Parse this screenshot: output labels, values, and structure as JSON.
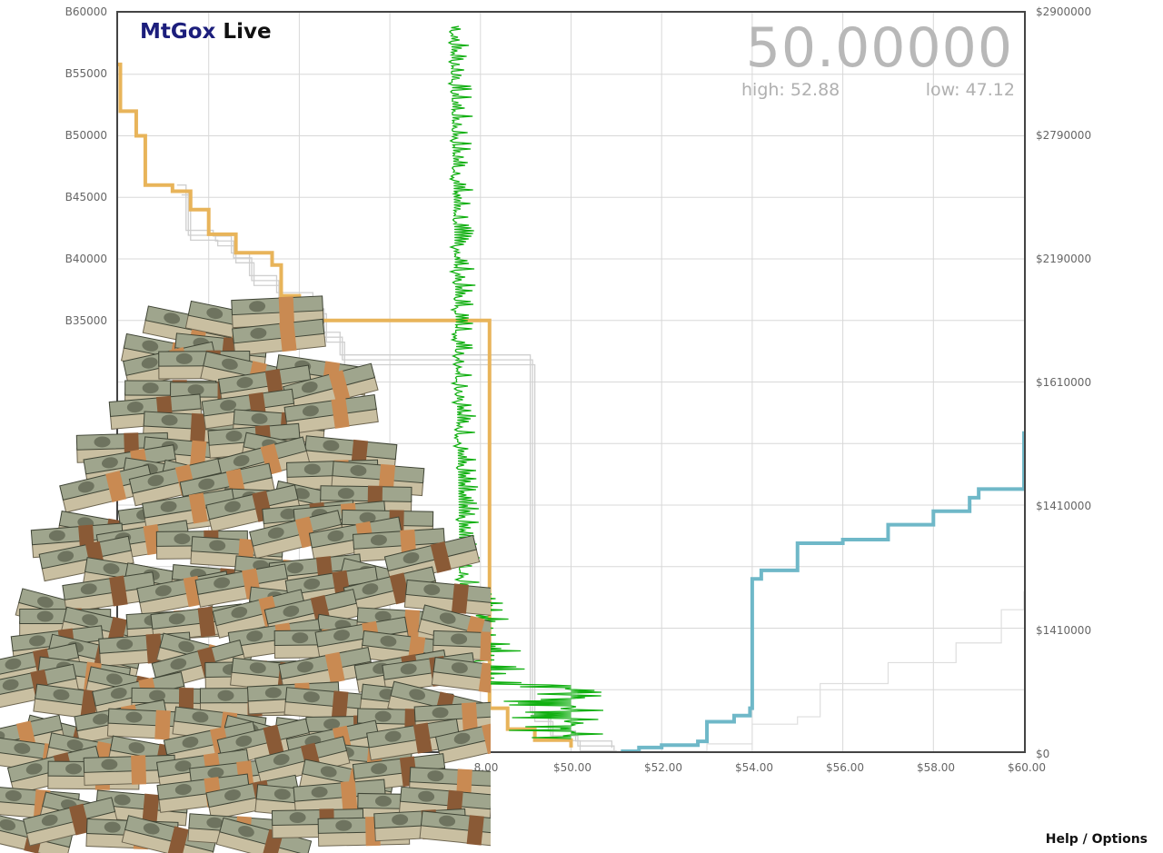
{
  "brand": {
    "part1": "MtGox",
    "part2": "Live"
  },
  "ticker": {
    "price": "50.00000",
    "high": "high: 52.88",
    "low": "low: 47.12"
  },
  "help_label": "Help / Options",
  "colors": {
    "bids": "#e8b45a",
    "asks": "#6fb8c8",
    "trades": "#12b012",
    "shadow": "#cfcfcf",
    "grid": "#d8d8d8"
  },
  "overlay_image": "pile-of-cash-image",
  "chart_data": {
    "type": "line",
    "title": "",
    "x_ticks": [
      "8.00",
      "$50.00",
      "$52.00",
      "$54.00",
      "$56.00",
      "$58.00",
      "$60.00"
    ],
    "y_left_ticks": [
      "B60000",
      "B55000",
      "B50000",
      "B45000",
      "B40000",
      "B35000"
    ],
    "y_right_ticks": [
      "$2900000",
      "$2790000",
      "$2190000",
      "$1610000",
      "$1410000",
      "$1410000",
      "$0"
    ],
    "xlim": [
      40,
      60
    ],
    "series": [],
    "bids_depth": [
      [
        40.0,
        55800
      ],
      [
        40.05,
        52000
      ],
      [
        40.4,
        50000
      ],
      [
        40.6,
        46000
      ],
      [
        41.2,
        45500
      ],
      [
        41.6,
        44000
      ],
      [
        42.0,
        42000
      ],
      [
        42.6,
        40500
      ],
      [
        43.4,
        39500
      ],
      [
        43.6,
        37000
      ],
      [
        44,
        35000
      ],
      [
        48.2,
        3500
      ],
      [
        48.6,
        1800
      ],
      [
        49.2,
        900
      ],
      [
        50.0,
        300
      ]
    ],
    "asks_depth": [
      [
        51.1,
        0
      ],
      [
        51.5,
        300
      ],
      [
        52.0,
        500
      ],
      [
        52.8,
        800
      ],
      [
        53.0,
        2400
      ],
      [
        53.6,
        2900
      ],
      [
        53.95,
        3500
      ],
      [
        54.0,
        14000
      ],
      [
        54.2,
        14700
      ],
      [
        55.0,
        15500
      ],
      [
        55.0,
        16900
      ],
      [
        56.0,
        17200
      ],
      [
        57.0,
        18400
      ],
      [
        58.0,
        19500
      ],
      [
        58.8,
        20600
      ],
      [
        59.0,
        21300
      ],
      [
        60.0,
        22800
      ],
      [
        60.0,
        26000
      ]
    ],
    "trade_history_x_range": [
      47.2,
      48.0
    ]
  }
}
